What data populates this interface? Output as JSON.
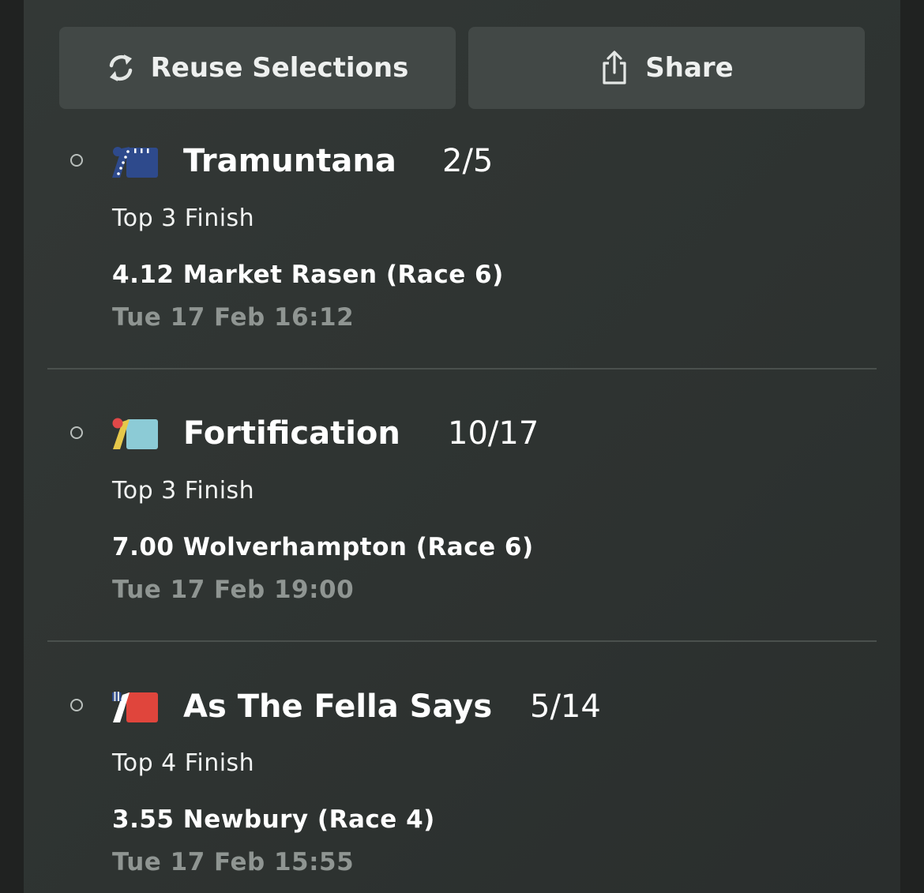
{
  "actions": {
    "reuse_label": "Reuse Selections",
    "reuse_icon": "refresh-icon",
    "share_label": "Share",
    "share_icon": "share-icon"
  },
  "selections": [
    {
      "runner": "Tramuntana",
      "odds": "2/5",
      "market": "Top 3 Finish",
      "race": "4.12 Market Rasen (Race 6)",
      "datetime": "Tue 17 Feb 16:12",
      "silk_colors": {
        "body": "#2e4a8c",
        "accent": "#ffffff"
      }
    },
    {
      "runner": "Fortification",
      "odds": "10/17",
      "market": "Top 3 Finish",
      "race": "7.00 Wolverhampton (Race 6)",
      "datetime": "Tue 17 Feb 19:00",
      "silk_colors": {
        "body": "#8ccbd6",
        "accent": "#e6c84a",
        "cap": "#e04848"
      }
    },
    {
      "runner": "As The Fella Says",
      "odds": "5/14",
      "market": "Top 4 Finish",
      "race": "3.55 Newbury (Race 4)",
      "datetime": "Tue 17 Feb 15:55",
      "silk_colors": {
        "body": "#e0453c",
        "accent": "#ffffff",
        "cap": "#2e4a8c"
      }
    }
  ]
}
